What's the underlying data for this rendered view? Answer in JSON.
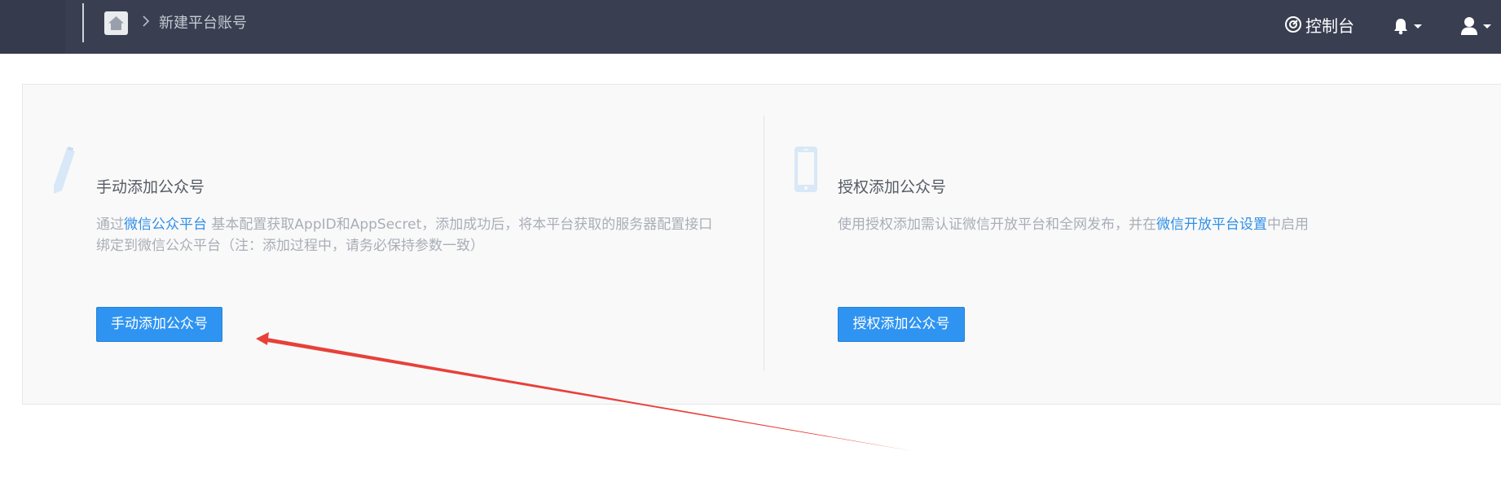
{
  "header": {
    "breadcrumb": "新建平台账号",
    "dashboard_label": "控制台",
    "icons": [
      "home-icon",
      "chevron-right-icon",
      "dashboard-icon",
      "bell-icon",
      "user-icon",
      "caret-down-icon"
    ]
  },
  "cards": {
    "manual": {
      "icon": "pencil-icon",
      "title": "手动添加公众号",
      "desc_prefix": "通过",
      "desc_link": "微信公众平台",
      "desc_suffix": " 基本配置获取AppID和AppSecret，添加成功后，将本平台获取的服务器配置接口",
      "desc_line2": "绑定到微信公众平台（注：添加过程中，请务必保持参数一致）",
      "button": "手动添加公众号"
    },
    "authorize": {
      "icon": "phone-icon",
      "title": "授权添加公众号",
      "desc_prefix": "使用授权添加需认证微信开放平台和全网发布，并在",
      "desc_link": "微信开放平台设置",
      "desc_suffix": "中启用",
      "button": "授权添加公众号"
    }
  },
  "colors": {
    "topbar": "#393f51",
    "primary": "#2f94f1",
    "link": "#2f8fe8",
    "annotation_arrow": "#e8403a"
  }
}
